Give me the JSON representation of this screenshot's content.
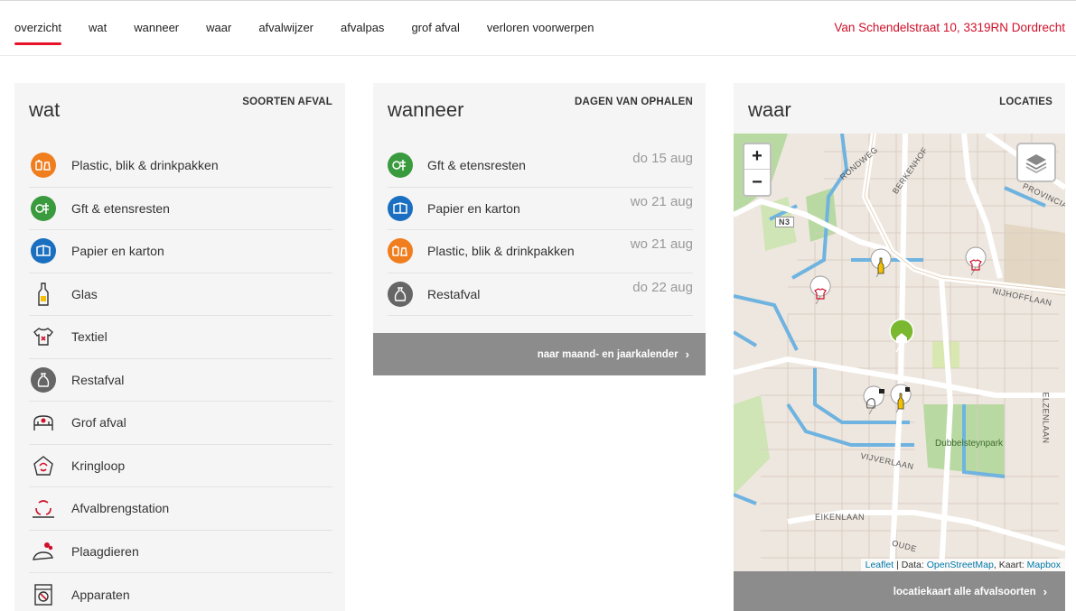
{
  "nav": {
    "links": [
      "overzicht",
      "wat",
      "wanneer",
      "waar",
      "afvalwijzer",
      "afvalpas",
      "grof afval",
      "verloren voorwerpen"
    ],
    "address": "Van Schendelstraat 10, 3319RN Dordrecht"
  },
  "wat": {
    "title": "wat",
    "subtitle": "SOORTEN AFVAL",
    "items": [
      {
        "label": "Plastic, blik & drinkpakken",
        "icon": "plastic-icon",
        "color": "#f07d1e"
      },
      {
        "label": "Gft & etensresten",
        "icon": "gft-icon",
        "color": "#3a9a3e"
      },
      {
        "label": "Papier en karton",
        "icon": "papier-icon",
        "color": "#1a6fc0"
      },
      {
        "label": "Glas",
        "icon": "glas-icon",
        "color": "#333333"
      },
      {
        "label": "Textiel",
        "icon": "textiel-icon",
        "color": "#333333"
      },
      {
        "label": "Restafval",
        "icon": "restafval-icon",
        "color": "#666666"
      },
      {
        "label": "Grof afval",
        "icon": "grof-afval-icon",
        "color": "#333333"
      },
      {
        "label": "Kringloop",
        "icon": "kringloop-icon",
        "color": "#d0102a"
      },
      {
        "label": "Afvalbrengstation",
        "icon": "afvalbrengstation-icon",
        "color": "#d0102a"
      },
      {
        "label": "Plaagdieren",
        "icon": "plaagdieren-icon",
        "color": "#d0102a"
      },
      {
        "label": "Apparaten",
        "icon": "apparaten-icon",
        "color": "#333333"
      }
    ]
  },
  "wanneer": {
    "title": "wanneer",
    "subtitle": "DAGEN VAN OPHALEN",
    "items": [
      {
        "label": "Gft & etensresten",
        "date": "do 15 aug",
        "icon": "gft-icon",
        "color": "#3a9a3e"
      },
      {
        "label": "Papier en karton",
        "date": "wo 21 aug",
        "icon": "papier-icon",
        "color": "#1a6fc0"
      },
      {
        "label": "Plastic, blik & drinkpakken",
        "date": "wo 21 aug",
        "icon": "plastic-icon",
        "color": "#f07d1e"
      },
      {
        "label": "Restafval",
        "date": "do 22 aug",
        "icon": "restafval-icon",
        "color": "#666666"
      }
    ],
    "button": "naar maand- en jaarkalender"
  },
  "waar": {
    "title": "waar",
    "subtitle": "LOCATIES",
    "zoom_in": "+",
    "zoom_out": "−",
    "attribution": {
      "leaflet": "Leaflet",
      "data_prefix": " | Data: ",
      "osm": "OpenStreetMap",
      "kaart_prefix": ", Kaart: ",
      "mapbox": "Mapbox"
    },
    "button": "locatiekaart alle afvalsoorten",
    "map_labels": [
      "RONDWEG",
      "BERKENHOF",
      "PROVINCIA",
      "N3",
      "NIJHOFFLAAN",
      "Dubbelsteynpark",
      "VIJVERLAAN",
      "ELZENLAAN",
      "EIKENLAAN",
      "OUDE"
    ]
  }
}
